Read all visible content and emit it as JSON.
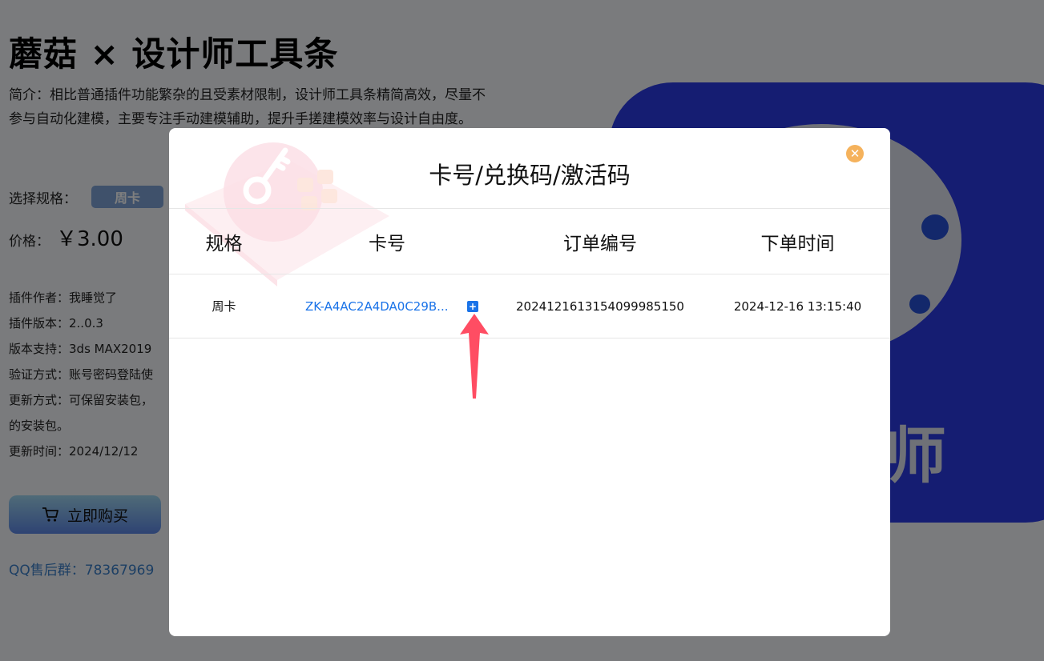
{
  "product": {
    "title": "蘑菇 × 设计师工具条",
    "intro": "简介：相比普通插件功能繁杂的且受素材限制，设计师工具条精简高效，尽量不参与自动化建模，主要专注手动建模辅助，提升手搓建模效率与设计自由度。",
    "spec_label": "选择规格：",
    "spec_selected": "周卡",
    "price_label": "价格：",
    "price_value": "￥3.00",
    "info": [
      "插件作者：我睡觉了",
      "插件版本：2..0.3",
      "版本支持：3ds MAX2019",
      "验证方式：账号密码登陆使",
      "更新方式：可保留安装包，",
      "的安装包。",
      "更新时间：2024/12/12"
    ],
    "buy_label": "立即购买",
    "qq_group": "QQ售后群：78367969",
    "icon_char": "师"
  },
  "modal": {
    "title": "卡号/兑换码/激活码",
    "close_icon": "close-circle-icon",
    "headers": [
      "规格",
      "卡号",
      "订单编号",
      "下单时间"
    ],
    "rows": [
      {
        "spec": "周卡",
        "card_no": "ZK-A4AC2A4DA0C29B...",
        "order_no": "2024121613154099985150",
        "order_time": "2024-12-16 13:15:40"
      }
    ]
  },
  "colors": {
    "accent_link": "#1a73e8",
    "close_button": "#f5b25c",
    "annotation_arrow": "#ff4d63",
    "app_icon_bg": "#2b3ae4"
  }
}
